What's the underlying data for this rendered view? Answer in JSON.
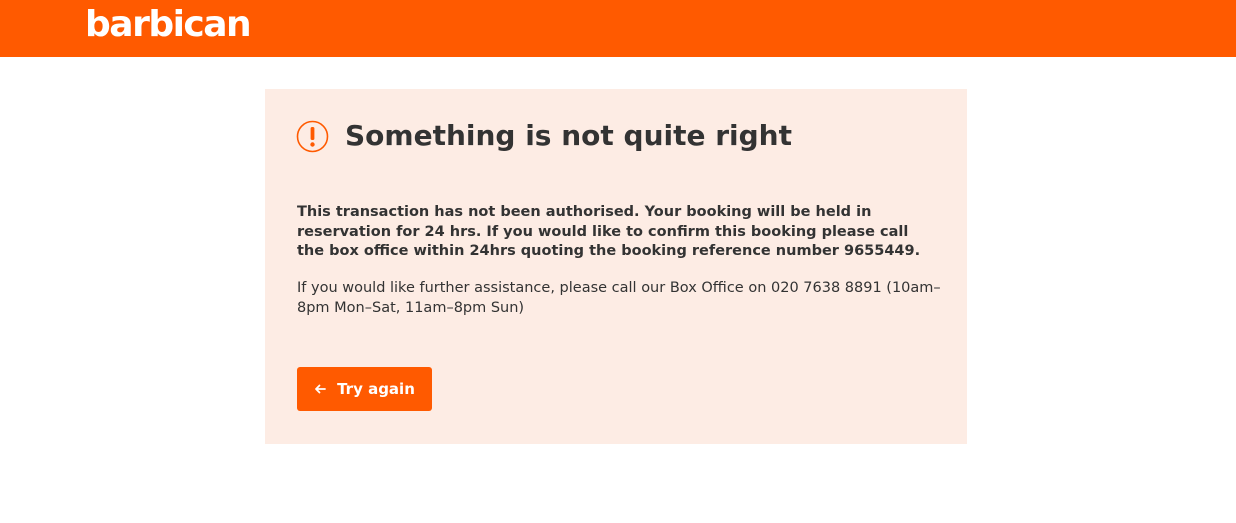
{
  "header": {
    "logo_text": "barbican",
    "brand_color": "#ff5a00"
  },
  "error": {
    "icon": "exclamation-circle-icon",
    "title": "Something is not quite right",
    "notice": "This transaction has not been authorised. Your booking will be held in reservation for 24 hrs. If you would like to confirm this booking please call the box office within 24hrs quoting the booking reference number 9655449.",
    "assistance": "If you would like further assistance, please call our Box Office on 020 7638 8891 (10am–8pm Mon–Sat, 11am–8pm Sun)",
    "panel_color": "#fdece4"
  },
  "actions": {
    "try_again_label": "Try again",
    "try_again_icon": "arrow-left-icon"
  }
}
